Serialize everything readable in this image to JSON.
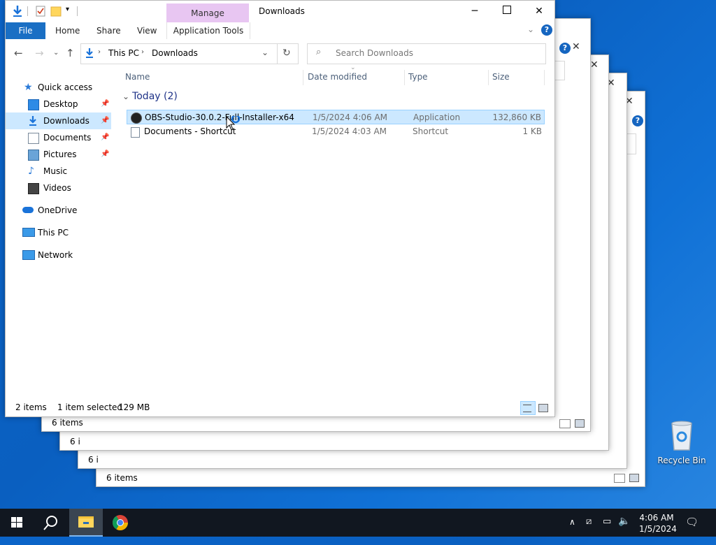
{
  "background_windows": [
    {
      "status": "6 items"
    },
    {
      "status": "6 i"
    },
    {
      "status": "6 i"
    },
    {
      "status": "6 items"
    }
  ],
  "explorer": {
    "title": "Downloads",
    "context_tab_group": "Manage",
    "ribbon_tabs": {
      "file": "File",
      "home": "Home",
      "share": "Share",
      "view": "View",
      "app_tools": "Application Tools"
    },
    "breadcrumb": [
      "This PC",
      "Downloads"
    ],
    "search_placeholder": "Search Downloads",
    "sidebar": {
      "quick_access": "Quick access",
      "desktop": "Desktop",
      "downloads": "Downloads",
      "documents": "Documents",
      "pictures": "Pictures",
      "music": "Music",
      "videos": "Videos",
      "onedrive": "OneDrive",
      "this_pc": "This PC",
      "network": "Network"
    },
    "columns": {
      "name": "Name",
      "date": "Date modified",
      "type": "Type",
      "size": "Size"
    },
    "group_label": "Today (2)",
    "files": [
      {
        "name": "OBS-Studio-30.0.2-Full-Installer-x64",
        "date": "1/5/2024 4:06 AM",
        "type": "Application",
        "size": "132,860 KB"
      },
      {
        "name": "Documents - Shortcut",
        "date": "1/5/2024 4:03 AM",
        "type": "Shortcut",
        "size": "1 KB"
      }
    ],
    "status": {
      "count": "2 items",
      "selected": "1 item selected",
      "size": "129 MB"
    }
  },
  "desktop": {
    "recycle_bin": "Recycle Bin"
  },
  "taskbar": {
    "time": "4:06 AM",
    "date": "1/5/2024"
  },
  "colors": {
    "accent": "#1a6fc4",
    "selection": "#cce8ff",
    "context_tab": "#e8c6f2"
  }
}
